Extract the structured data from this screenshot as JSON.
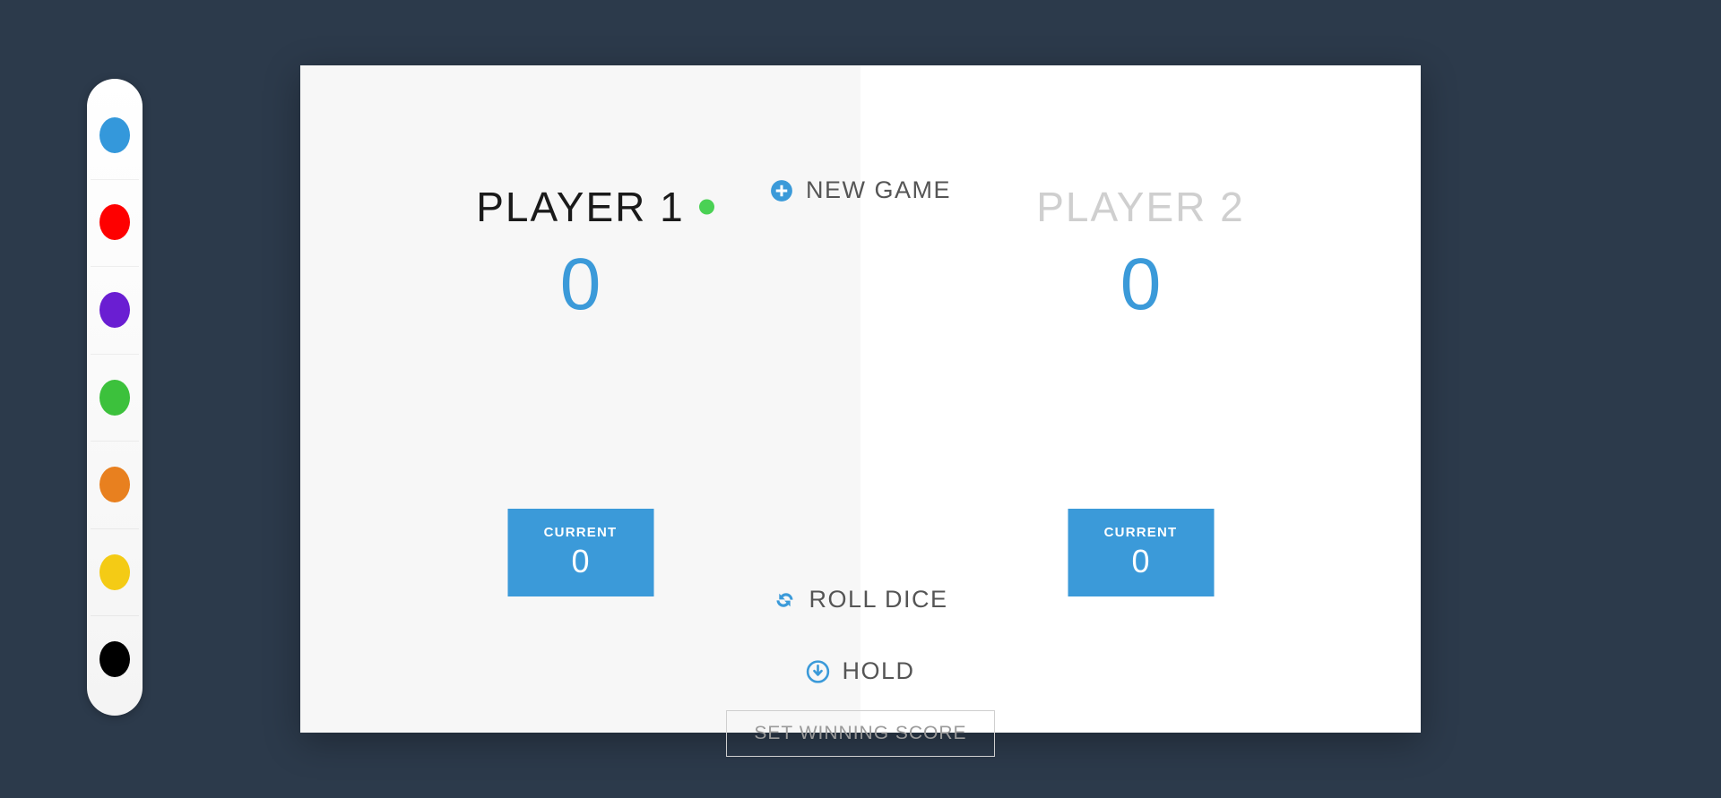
{
  "background_color": "#2c3a4b",
  "sidebar": {
    "name": "color-picker",
    "swatches": [
      {
        "name": "blue",
        "color": "#3498db"
      },
      {
        "name": "red",
        "color": "#fe0000"
      },
      {
        "name": "purple",
        "color": "#6a1ed2"
      },
      {
        "name": "green",
        "color": "#3cc13c"
      },
      {
        "name": "orange",
        "color": "#e8801f"
      },
      {
        "name": "yellow",
        "color": "#f4cb15"
      },
      {
        "name": "black",
        "color": "#000000"
      }
    ]
  },
  "game": {
    "panel_bg_left": "#f7f7f7",
    "panel_bg_right": "#ffffff",
    "accent_color": "#3b9ad9",
    "active_dot_color": "#4ad154",
    "new_game_label": "NEW GAME",
    "new_game_icon": "plus-circle-icon",
    "roll_dice_label": "ROLL DICE",
    "roll_dice_icon": "refresh-icon",
    "hold_label": "HOLD",
    "hold_icon": "arrow-down-circle-icon",
    "winning_score_placeholder": "SET WINNING SCORE",
    "winning_score_value": "",
    "players": [
      {
        "name": "PLAYER 1",
        "score": "0",
        "current_label": "CURRENT",
        "current_score": "0",
        "active": true
      },
      {
        "name": "PLAYER 2",
        "score": "0",
        "current_label": "CURRENT",
        "current_score": "0",
        "active": false
      }
    ]
  }
}
